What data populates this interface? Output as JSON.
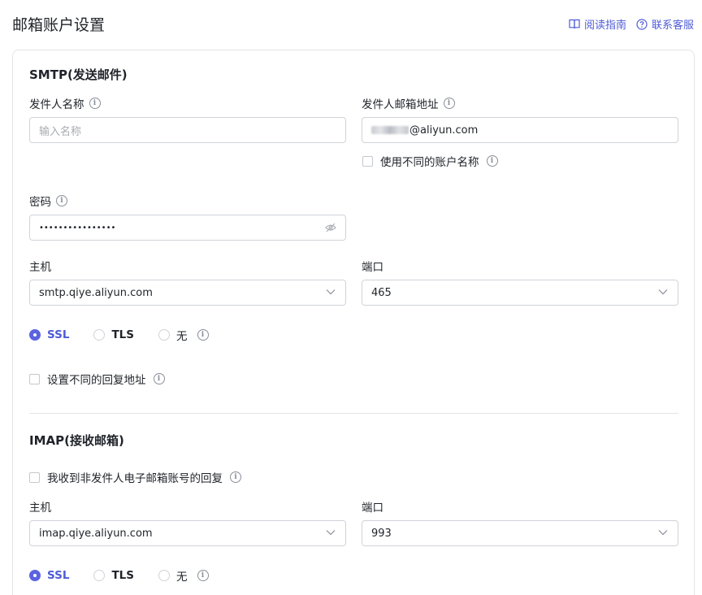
{
  "header": {
    "title": "邮箱账户设置",
    "guide_link": "阅读指南",
    "support_link": "联系客服"
  },
  "smtp": {
    "section_title": "SMTP(发送邮件)",
    "sender_name_label": "发件人名称",
    "sender_name_placeholder": "输入名称",
    "sender_email_label": "发件人邮箱地址",
    "sender_email_value": "@aliyun.com",
    "different_account_label": "使用不同的账户名称",
    "password_label": "密码",
    "password_value": "••••••••••••••••",
    "host_label": "主机",
    "host_value": "smtp.qiye.aliyun.com",
    "port_label": "端口",
    "port_value": "465",
    "security_options": [
      "SSL",
      "TLS",
      "无"
    ],
    "security_selected": "SSL",
    "reply_address_label": "设置不同的回复地址"
  },
  "imap": {
    "section_title": "IMAP(接收邮箱)",
    "non_sender_reply_label": "我收到非发件人电子邮箱账号的回复",
    "host_label": "主机",
    "host_value": "imap.qiye.aliyun.com",
    "port_label": "端口",
    "port_value": "993",
    "security_options": [
      "SSL",
      "TLS",
      "无"
    ],
    "security_selected": "SSL"
  },
  "colors": {
    "accent": "#5b63e0",
    "link": "#4e5bd6",
    "border": "#d0d3d9",
    "text": "#1f2329"
  }
}
